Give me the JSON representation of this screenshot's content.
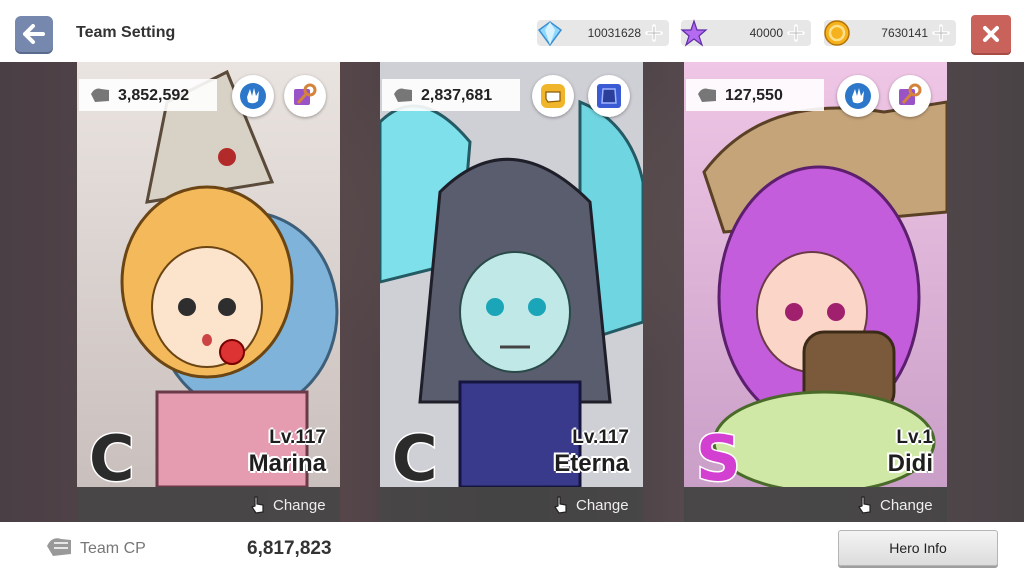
{
  "header": {
    "title": "Team Setting",
    "currencies": [
      {
        "icon": "diamond-icon",
        "value": "10031628"
      },
      {
        "icon": "star-crystal-icon",
        "value": "40000"
      },
      {
        "icon": "gold-coin-icon",
        "value": "7630141"
      }
    ]
  },
  "heroes": [
    {
      "cp": "3,852,592",
      "grade": "C",
      "level": "Lv.117",
      "name": "Marina",
      "change_label": "Change",
      "badges": [
        "hand-class-icon",
        "key-item-icon"
      ]
    },
    {
      "cp": "2,837,681",
      "grade": "C",
      "level": "Lv.117",
      "name": "Eterna",
      "change_label": "Change",
      "badges": [
        "fist-class-icon",
        "armor-item-icon"
      ]
    },
    {
      "cp": "127,550",
      "grade": "S",
      "level": "Lv.1",
      "name": "Didi",
      "change_label": "Change",
      "badges": [
        "hand-class-icon",
        "key-item-icon"
      ]
    }
  ],
  "footer": {
    "team_cp_label": "Team CP",
    "team_cp_value": "6,817,823",
    "hero_info_label": "Hero Info"
  },
  "colors": {
    "grade_c": "#2b2b2b",
    "grade_s": "#d33fd0",
    "close_button": "#c9625a",
    "back_button": "#7688ad"
  }
}
